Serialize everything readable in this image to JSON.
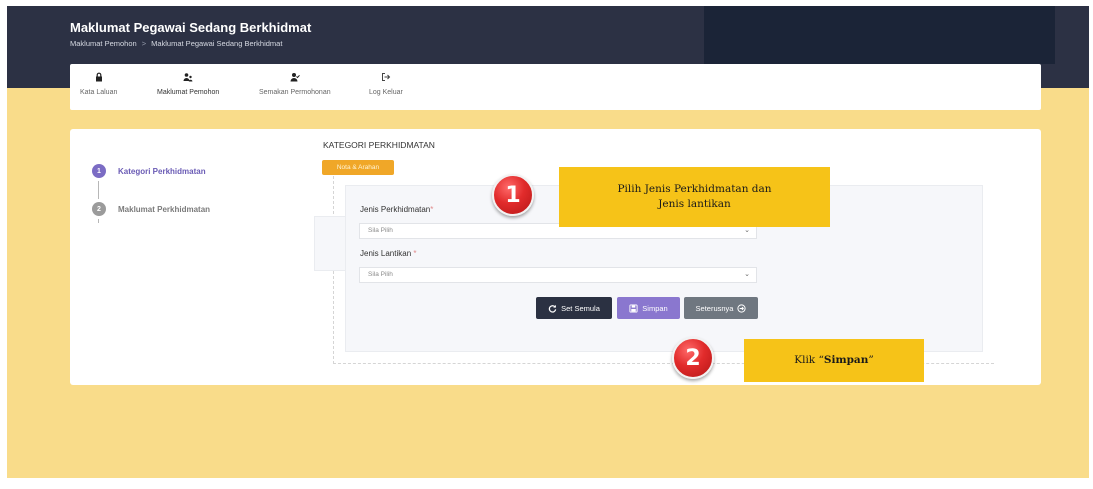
{
  "header": {
    "title": "Maklumat Pegawai Sedang Berkhidmat",
    "breadcrumb": [
      "Maklumat Pemohon",
      "Maklumat Pegawai Sedang Berkhidmat"
    ],
    "breadcrumb_separator": ">"
  },
  "nav": {
    "items": [
      {
        "label": "Kata Laluan",
        "icon": "lock-icon"
      },
      {
        "label": "Maklumat Pemohon",
        "icon": "users-icon"
      },
      {
        "label": "Semakan Permohonan",
        "icon": "user-check-icon"
      },
      {
        "label": "Log Keluar",
        "icon": "sign-out-icon"
      }
    ]
  },
  "steps": [
    {
      "number": "1",
      "label": "Kategori Perkhidmatan"
    },
    {
      "number": "2",
      "label": "Maklumat Perkhidmatan"
    }
  ],
  "form": {
    "section_title": "KATEGORI PERKHIDMATAN",
    "note_button": "Nota & Arahan",
    "field1": {
      "label": "Jenis Perkhidmatan",
      "required_mark": "*",
      "value": "Sila Pilih"
    },
    "field2": {
      "label": "Jenis Lantikan",
      "required_mark": "*",
      "value": "Sila Pilih"
    },
    "buttons": {
      "reset": "Set Semula",
      "save": "Simpan",
      "next": "Seterusnya"
    }
  },
  "annotations": {
    "callout1": {
      "line1": "Pilih Jenis Perkhidmatan dan",
      "line2": "Jenis lantikan",
      "badge": "1"
    },
    "callout2": {
      "prefix": "Klik “",
      "bold": "Simpan",
      "suffix": "”",
      "badge": "2"
    }
  },
  "colors": {
    "header_bg": "#2c3144",
    "page_bg": "#f9dc8a",
    "accent_purple": "#8a77cf",
    "note_orange": "#f0a728",
    "callout_yellow": "#f6c318",
    "badge_red": "#e12b2b"
  }
}
